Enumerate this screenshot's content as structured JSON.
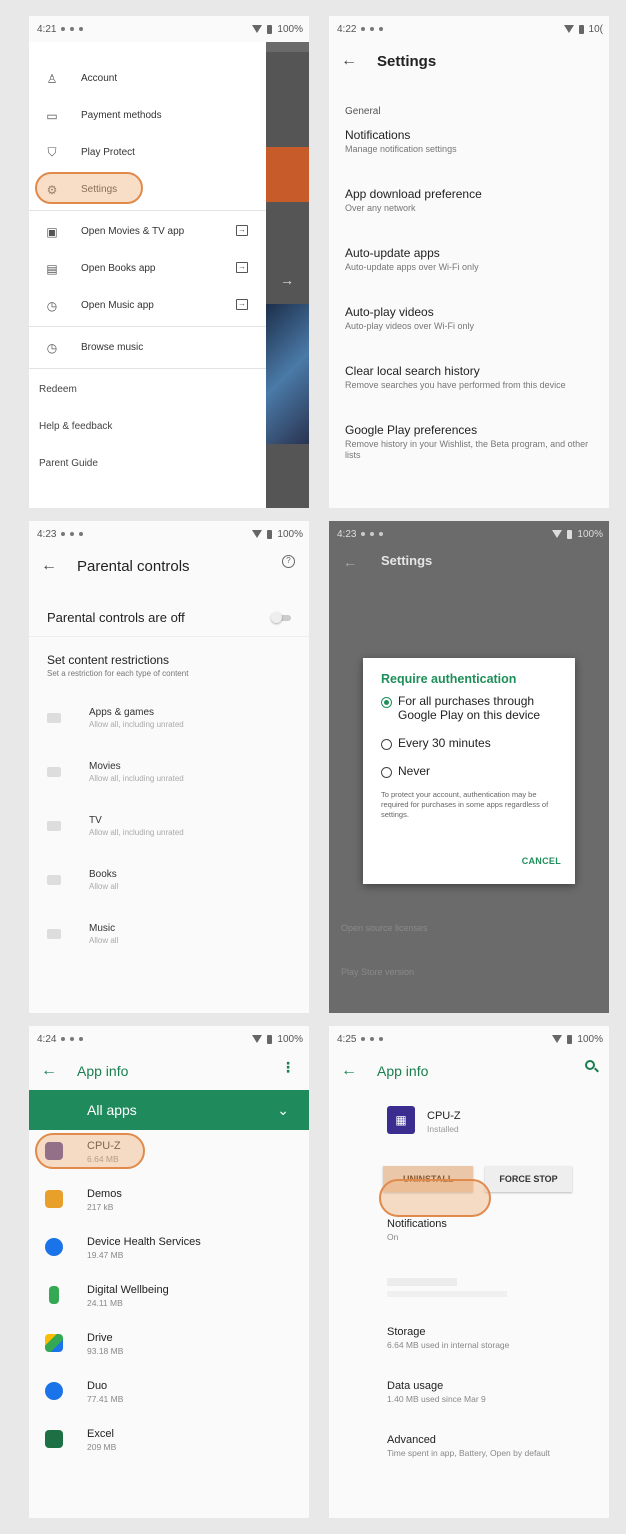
{
  "panels": {
    "p1": {
      "time": "4:21",
      "battery": "100%",
      "menu": [
        {
          "label": "Account",
          "icon": "account-icon"
        },
        {
          "label": "Payment methods",
          "icon": "card-icon"
        },
        {
          "label": "Play Protect",
          "icon": "shield-icon"
        },
        {
          "label": "Settings",
          "icon": "gear-icon"
        },
        {
          "label": "Open Movies & TV app",
          "icon": "movie-icon"
        },
        {
          "label": "Open Books app",
          "icon": "book-icon"
        },
        {
          "label": "Open Music app",
          "icon": "music-icon"
        },
        {
          "label": "Browse music",
          "icon": "music-icon"
        }
      ],
      "footer": [
        "Redeem",
        "Help & feedback",
        "Parent Guide"
      ]
    },
    "p2": {
      "time": "4:22",
      "battery": "10(",
      "title": "Settings",
      "section": "General",
      "rows": [
        {
          "title": "Notifications",
          "subtitle": "Manage notification settings"
        },
        {
          "title": "App download preference",
          "subtitle": "Over any network"
        },
        {
          "title": "Auto-update apps",
          "subtitle": "Auto-update apps over Wi-Fi only"
        },
        {
          "title": "Auto-play videos",
          "subtitle": "Auto-play videos over Wi-Fi only"
        },
        {
          "title": "Clear local search history",
          "subtitle": "Remove searches you have performed from this device"
        },
        {
          "title": "Google Play preferences",
          "subtitle": "Remove history in your Wishlist, the Beta program, and other lists"
        }
      ]
    },
    "p3": {
      "time": "4:23",
      "battery": "100%",
      "title": "Parental controls",
      "status": "Parental controls are off",
      "restrict_title": "Set content restrictions",
      "restrict_sub": "Set a restriction for each type of content",
      "items": [
        {
          "title": "Apps & games",
          "subtitle": "Allow all, including unrated"
        },
        {
          "title": "Movies",
          "subtitle": "Allow all, including unrated"
        },
        {
          "title": "TV",
          "subtitle": "Allow all, including unrated"
        },
        {
          "title": "Books",
          "subtitle": "Allow all"
        },
        {
          "title": "Music",
          "subtitle": "Allow all"
        }
      ]
    },
    "p4": {
      "time": "4:23",
      "battery": "100%",
      "bg_title": "Settings",
      "bg_items": [
        "Open source licenses",
        "Play Store version"
      ],
      "dialog": {
        "title": "Require authentication",
        "options": [
          "For all purchases through Google Play on this device",
          "Every 30 minutes",
          "Never"
        ],
        "note": "To protect your account, authentication may be required for purchases in some apps regardless of settings.",
        "cancel": "CANCEL"
      }
    },
    "p5": {
      "time": "4:24",
      "battery": "100%",
      "title": "App info",
      "filter": "All apps",
      "apps": [
        {
          "name": "CPU-Z",
          "size": "6.64 MB",
          "color": "#4a3a8c"
        },
        {
          "name": "Demos",
          "size": "217 kB",
          "color": "#e8a02a"
        },
        {
          "name": "Device Health Services",
          "size": "19.47 MB",
          "color": "#1a73e8"
        },
        {
          "name": "Digital Wellbeing",
          "size": "24.11 MB",
          "color": "#34a853"
        },
        {
          "name": "Drive",
          "size": "93.18 MB",
          "color": "#fbbc04"
        },
        {
          "name": "Duo",
          "size": "77.41 MB",
          "color": "#1a73e8"
        },
        {
          "name": "Excel",
          "size": "209 MB",
          "color": "#1d7044"
        }
      ]
    },
    "p6": {
      "time": "4:25",
      "battery": "100%",
      "title": "App info",
      "app_name": "CPU-Z",
      "app_status": "Installed",
      "uninstall": "UNINSTALL",
      "force_stop": "FORCE STOP",
      "rows": [
        {
          "title": "Notifications",
          "subtitle": "On"
        },
        {
          "title": "Storage",
          "subtitle": "6.64 MB used in internal storage"
        },
        {
          "title": "Data usage",
          "subtitle": "1.40 MB used since Mar 9"
        },
        {
          "title": "Advanced",
          "subtitle": "Time spent in app, Battery, Open by default"
        }
      ]
    }
  }
}
